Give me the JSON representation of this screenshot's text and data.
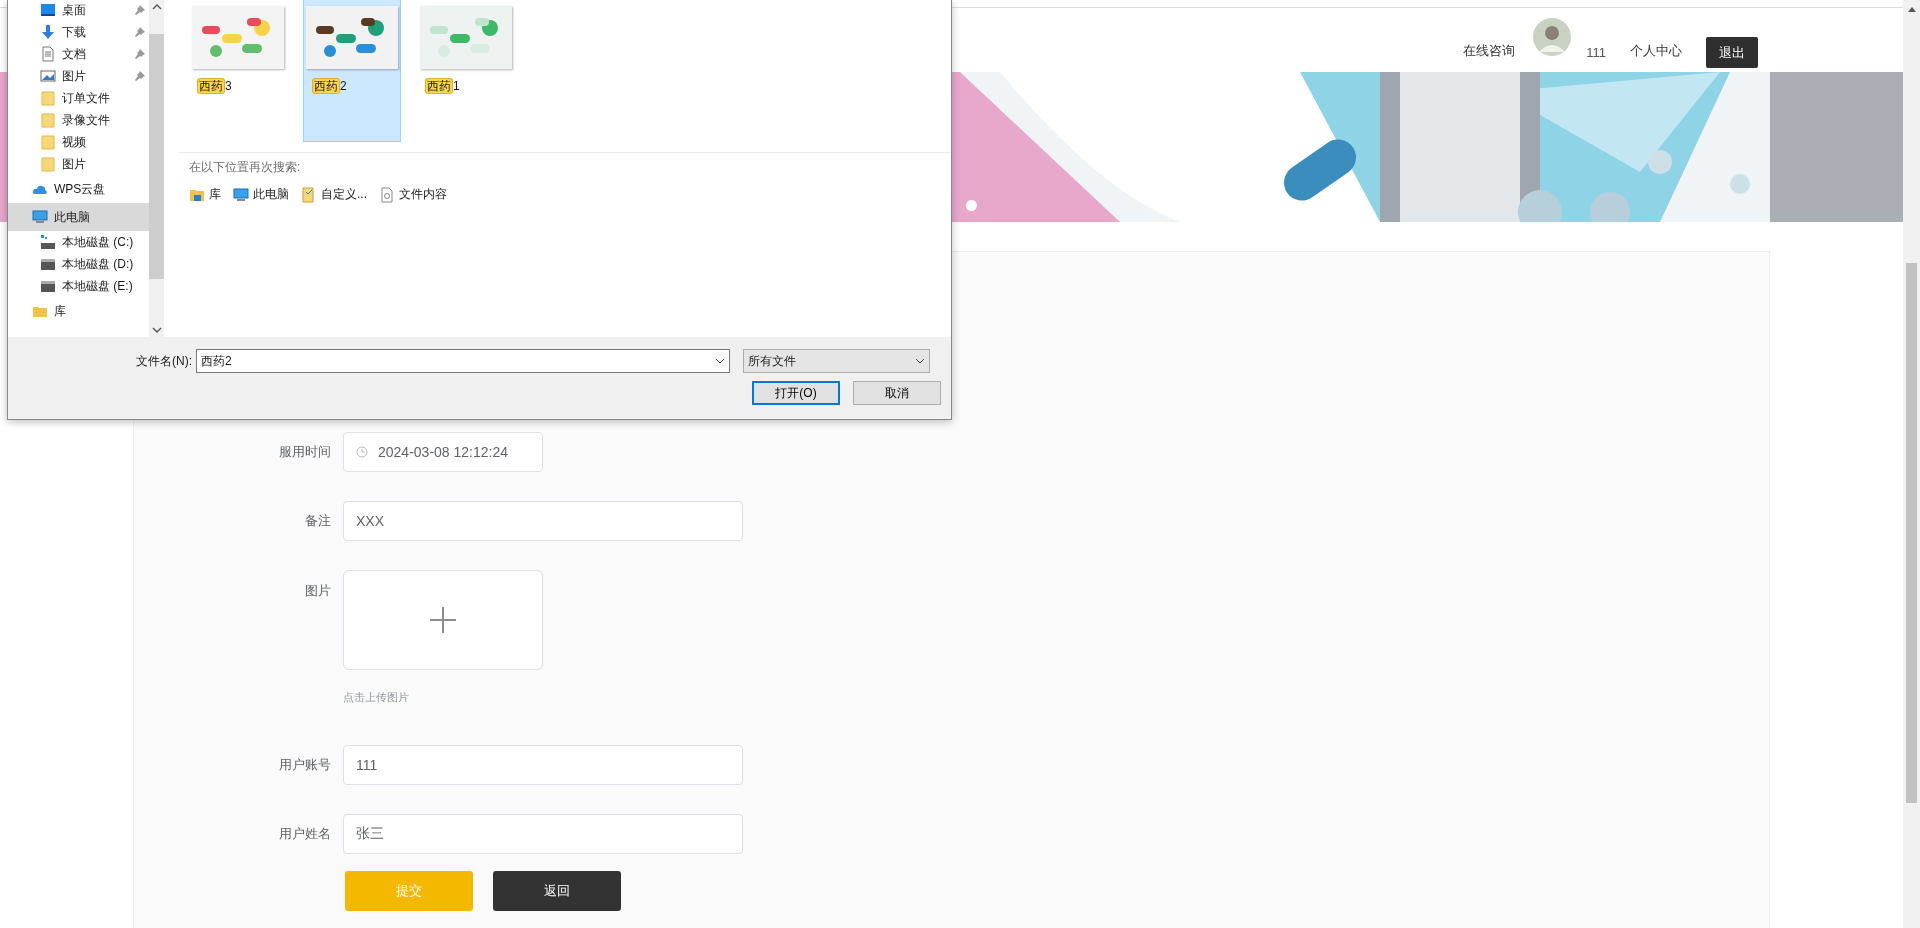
{
  "header": {
    "consult": "在线咨询",
    "username": "111",
    "profile": "个人中心",
    "logout": "退出"
  },
  "form": {
    "fields": [
      {
        "kind": "date",
        "label": "服用时间",
        "value": "2024-03-08 12:12:24"
      },
      {
        "kind": "text",
        "label": "备注",
        "value": "XXX"
      },
      {
        "kind": "upload",
        "label": "图片",
        "hint": "点击上传图片"
      },
      {
        "kind": "text",
        "label": "用户账号",
        "value": "111"
      },
      {
        "kind": "text",
        "label": "用户姓名",
        "value": "张三"
      }
    ],
    "buttons": [
      {
        "kind": "primary",
        "label": "提交"
      },
      {
        "kind": "dark",
        "label": "返回"
      }
    ]
  },
  "file_dialog": {
    "quick_access": [
      {
        "kind": "desktop",
        "label": "桌面",
        "pinned": true
      },
      {
        "kind": "download",
        "label": "下载",
        "pinned": true
      },
      {
        "kind": "document",
        "label": "文档",
        "pinned": true
      },
      {
        "kind": "pictures",
        "label": "图片",
        "pinned": true
      },
      {
        "kind": "folder",
        "label": "订单文件",
        "pinned": false
      },
      {
        "kind": "folder",
        "label": "录像文件",
        "pinned": false
      },
      {
        "kind": "folder",
        "label": "视频",
        "pinned": false
      },
      {
        "kind": "folder",
        "label": "图片",
        "pinned": false
      }
    ],
    "nav_tree": [
      {
        "kind": "cloud",
        "label": "WPS云盘",
        "selected": false
      },
      {
        "kind": "computer",
        "label": "此电脑",
        "selected": true,
        "children": [
          {
            "kind": "system-drive",
            "label": "本地磁盘 (C:)",
            "selected": false
          },
          {
            "kind": "drive",
            "label": "本地磁盘 (D:)",
            "selected": false
          },
          {
            "kind": "drive",
            "label": "本地磁盘 (E:)",
            "selected": false
          }
        ]
      },
      {
        "kind": "folder",
        "label": "库",
        "selected": false
      }
    ],
    "files": [
      {
        "match": "西药",
        "rest": "3",
        "selected": false
      },
      {
        "match": "西药",
        "rest": "2",
        "selected": true
      },
      {
        "match": "西药",
        "rest": "1",
        "selected": false
      }
    ],
    "search_again": {
      "title": "在以下位置再次搜索:",
      "locations": [
        {
          "kind": "library",
          "label": "库"
        },
        {
          "kind": "computer",
          "label": "此电脑"
        },
        {
          "kind": "custom",
          "label": "自定义..."
        },
        {
          "kind": "file",
          "label": "文件内容"
        }
      ]
    },
    "filename_label": "文件名(N):",
    "filename": "西药2",
    "filetype": "所有文件",
    "buttons": [
      {
        "kind": "default",
        "label": "打开(O)"
      },
      {
        "kind": "normal",
        "label": "取消"
      }
    ]
  }
}
